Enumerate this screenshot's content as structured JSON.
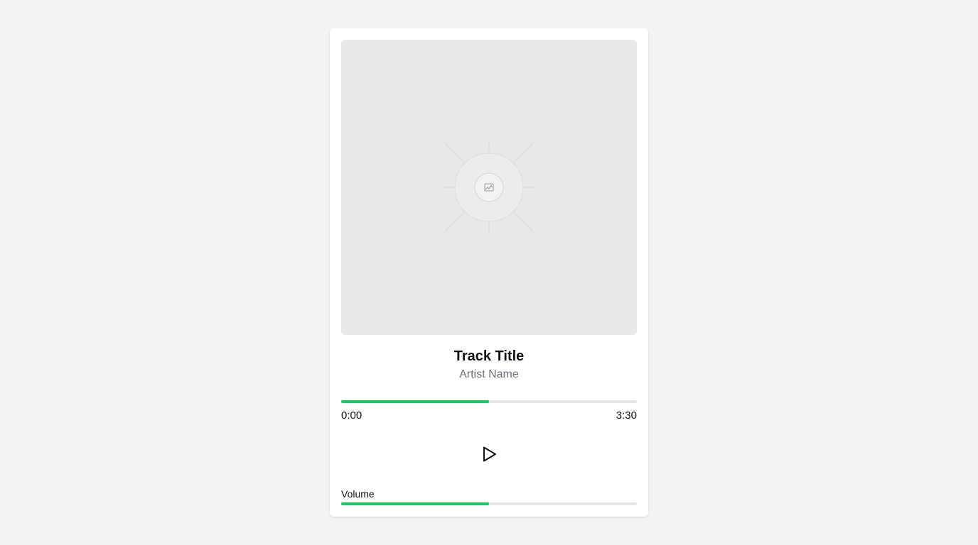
{
  "player": {
    "track_title": "Track Title",
    "artist_name": "Artist Name",
    "time_current": "0:00",
    "time_total": "3:30",
    "progress": 0.5,
    "volume_label": "Volume",
    "volume": 0.5,
    "accent_color": "#22c55e",
    "play_icon": "play-icon",
    "art_placeholder_icon": "image-icon"
  }
}
